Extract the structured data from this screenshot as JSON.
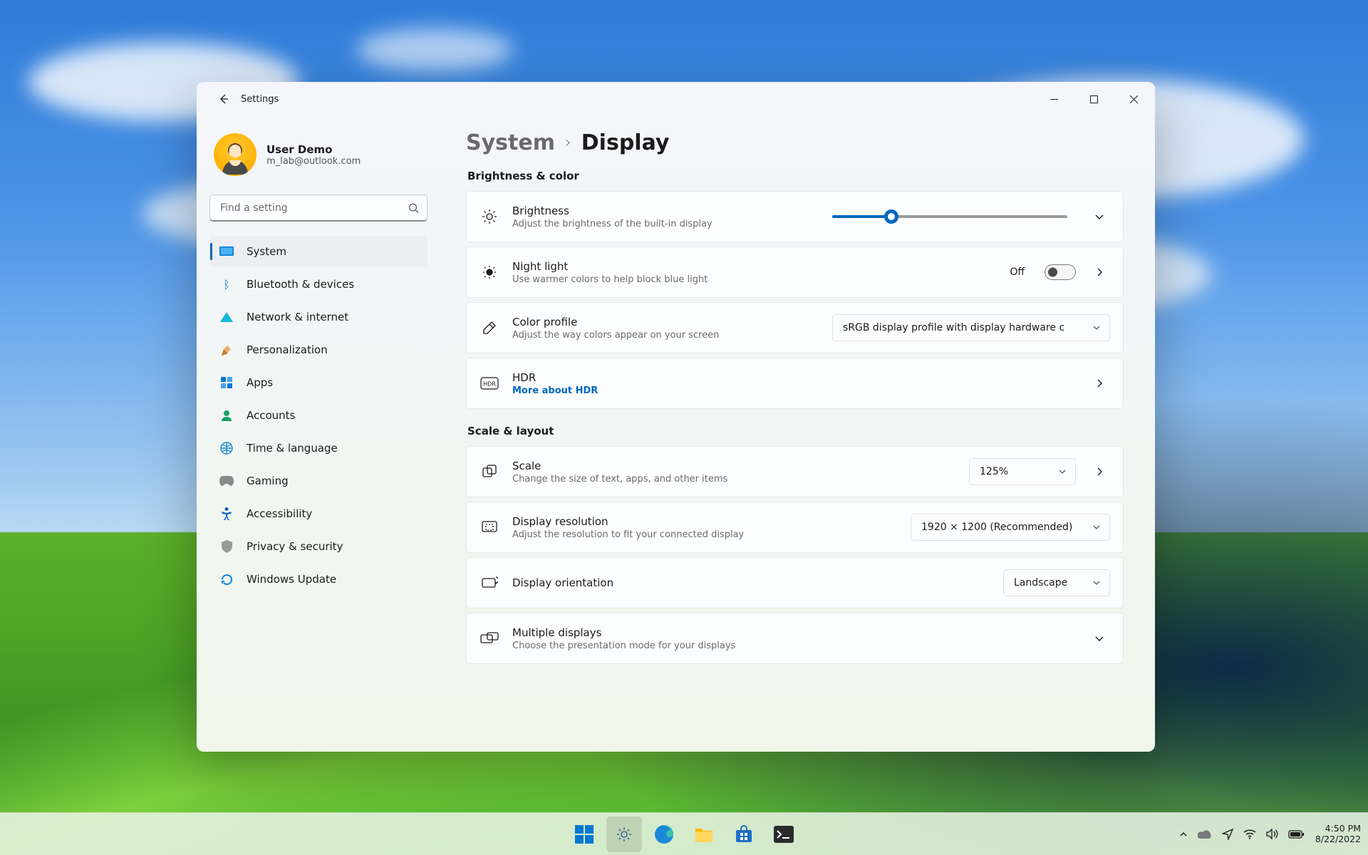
{
  "window": {
    "title": "Settings",
    "breadcrumb_parent": "System",
    "breadcrumb_sep": "›",
    "breadcrumb_current": "Display"
  },
  "user": {
    "name": "User Demo",
    "email": "m_lab@outlook.com"
  },
  "search": {
    "placeholder": "Find a setting"
  },
  "sidebar": {
    "items": [
      {
        "label": "System"
      },
      {
        "label": "Bluetooth & devices"
      },
      {
        "label": "Network & internet"
      },
      {
        "label": "Personalization"
      },
      {
        "label": "Apps"
      },
      {
        "label": "Accounts"
      },
      {
        "label": "Time & language"
      },
      {
        "label": "Gaming"
      },
      {
        "label": "Accessibility"
      },
      {
        "label": "Privacy & security"
      },
      {
        "label": "Windows Update"
      }
    ]
  },
  "sections": {
    "s1": "Brightness & color",
    "s2": "Scale & layout"
  },
  "brightness": {
    "title": "Brightness",
    "sub": "Adjust the brightness of the built-in display",
    "percent": 25
  },
  "nightlight": {
    "title": "Night light",
    "sub": "Use warmer colors to help block blue light",
    "state": "Off"
  },
  "colorprofile": {
    "title": "Color profile",
    "sub": "Adjust the way colors appear on your screen",
    "value": "sRGB display profile with display hardware c"
  },
  "hdr": {
    "title": "HDR",
    "link": "More about HDR"
  },
  "scale": {
    "title": "Scale",
    "sub": "Change the size of text, apps, and other items",
    "value": "125%"
  },
  "resolution": {
    "title": "Display resolution",
    "sub": "Adjust the resolution to fit your connected display",
    "value": "1920 × 1200 (Recommended)"
  },
  "orientation": {
    "title": "Display orientation",
    "value": "Landscape"
  },
  "multiple": {
    "title": "Multiple displays",
    "sub": "Choose the presentation mode for your displays"
  },
  "taskbar": {
    "time": "4:50 PM",
    "date": "8/22/2022"
  }
}
